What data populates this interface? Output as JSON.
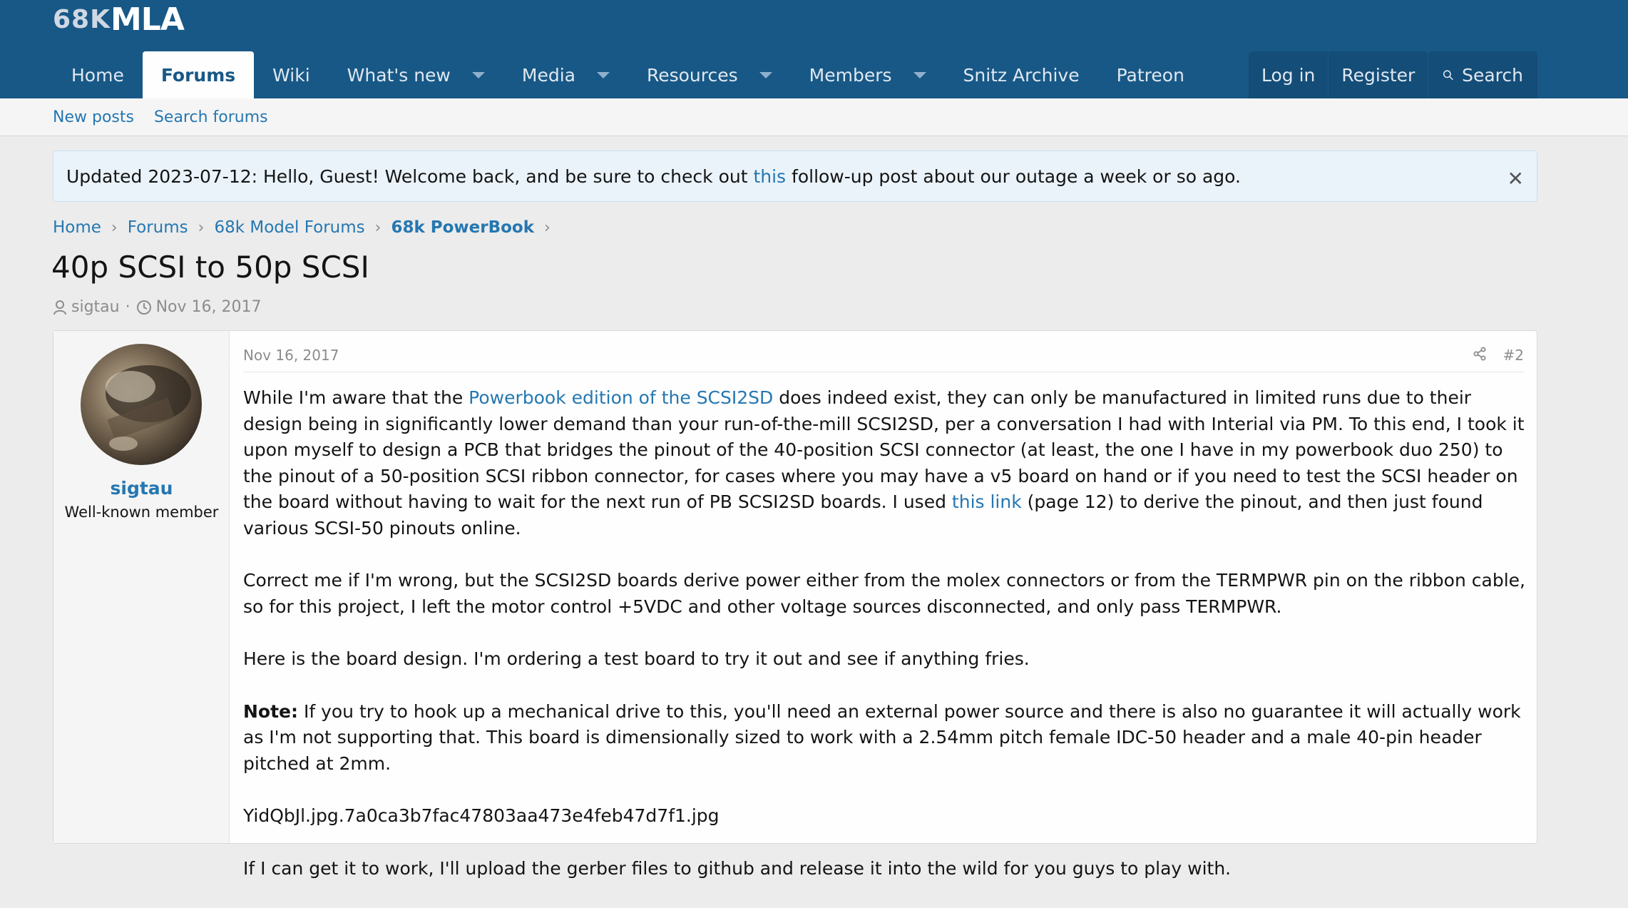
{
  "logo": {
    "prefix": "68K",
    "main": "MLA"
  },
  "nav": {
    "items": [
      {
        "label": "Home"
      },
      {
        "label": "Forums"
      },
      {
        "label": "Wiki"
      },
      {
        "label": "What's new"
      },
      {
        "label": "Media"
      },
      {
        "label": "Resources"
      },
      {
        "label": "Members"
      },
      {
        "label": "Snitz Archive"
      },
      {
        "label": "Patreon"
      }
    ],
    "login": "Log in",
    "register": "Register",
    "search": "Search"
  },
  "subnav": {
    "new_posts": "New posts",
    "search_forums": "Search forums"
  },
  "notice": {
    "before": "Updated 2023-07-12: Hello, Guest! Welcome back, and be sure to check out ",
    "link": "this",
    "after": " follow-up post about our outage a week or so ago.",
    "close": "✕"
  },
  "breadcrumb": [
    "Home",
    "Forums",
    "68k Model Forums",
    "68k PowerBook"
  ],
  "thread": {
    "title": "40p SCSI to 50p SCSI",
    "author": "sigtau",
    "date": "Nov 16, 2017"
  },
  "post": {
    "username": "sigtau",
    "user_title": "Well-known member",
    "date": "Nov 16, 2017",
    "number": "#2",
    "p1_a": "While I'm aware that the ",
    "p1_link": "Powerbook edition of the SCSI2SD",
    "p1_b": " does indeed exist, they can only be manufactured in limited runs due to their design being in significantly lower demand than your run-of-the-mill SCSI2SD, per a conversation I had with Interial via PM.  To this end, I took it upon myself to design a PCB that bridges the pinout of the 40-position SCSI connector (at least, the one I have in my powerbook duo 250) to the pinout of a 50-position SCSI ribbon connector, for cases where you may have a v5 board on hand or if you need to test the SCSI header on the board without having to wait for the next run of PB SCSI2SD boards.  I used ",
    "p1_link2": "this link",
    "p1_c": " (page 12) to derive the pinout, and then just found various SCSI-50 pinouts online.",
    "p2": "Correct me if I'm wrong, but the SCSI2SD boards derive power either from the molex connectors or from the TERMPWR pin on the ribbon cable, so for this project, I left the motor control +5VDC and other voltage sources disconnected, and only pass TERMPWR.",
    "p3": "Here is the board design.  I'm ordering a test board to try it out and see if anything fries.",
    "p4_bold": "Note:",
    "p4": " If you try to hook up a mechanical drive to this, you'll need an external power source and there is also no guarantee it will actually work as I'm not supporting that.  This board is dimensionally sized to work with a 2.54mm pitch female IDC-50 header and a male 40-pin header pitched at 2mm.",
    "p5": "YidQbJl.jpg.7a0ca3b7fac47803aa473e4feb47d7f1.jpg",
    "p6": "If I can get it to work, I'll upload the gerber files to github and release it into the wild for you guys to play with."
  }
}
